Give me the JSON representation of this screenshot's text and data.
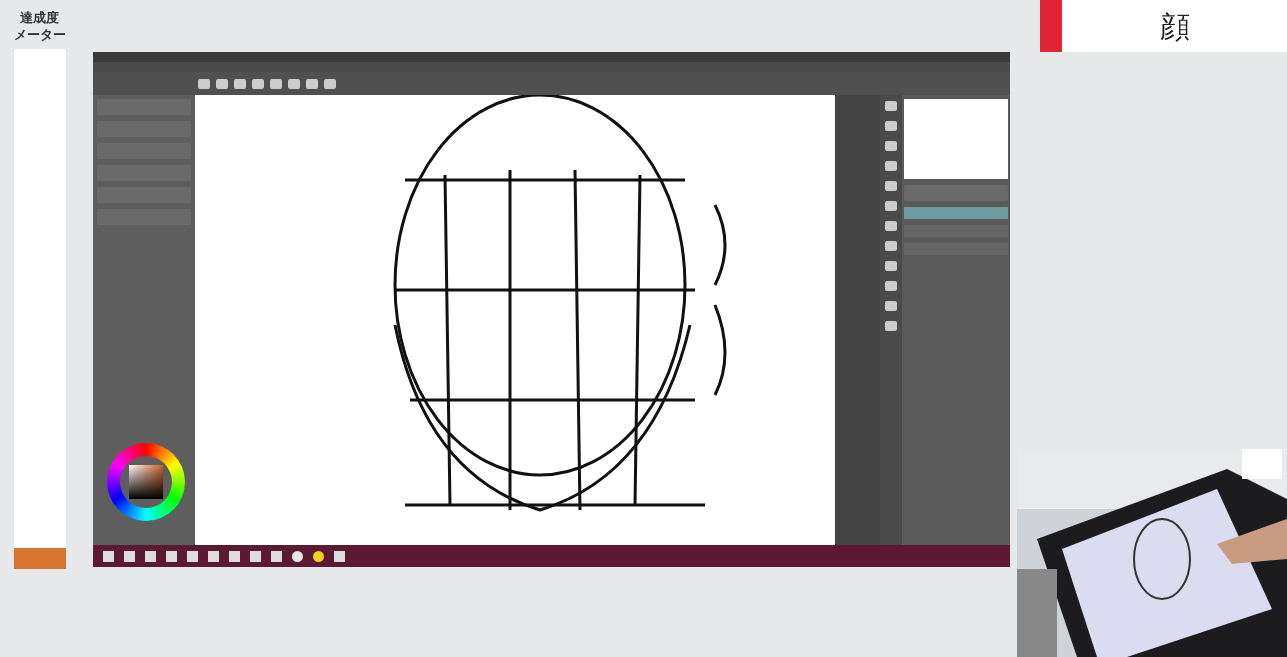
{
  "meter": {
    "label_lines": [
      "達成度",
      "メーター"
    ],
    "level": 0.04
  },
  "topic": {
    "title": "顔"
  },
  "app": {
    "layers": [
      {
        "selected": true
      },
      {
        "selected": false
      },
      {
        "selected": false
      }
    ],
    "taskbar_icons": [
      {
        "kind": "square"
      },
      {
        "kind": "square"
      },
      {
        "kind": "square"
      },
      {
        "kind": "square"
      },
      {
        "kind": "square"
      },
      {
        "kind": "square"
      },
      {
        "kind": "square"
      },
      {
        "kind": "square"
      },
      {
        "kind": "square"
      },
      {
        "kind": "circle",
        "color": "#e8e8e8"
      },
      {
        "kind": "circle",
        "color": "#f0d020"
      },
      {
        "kind": "square"
      }
    ]
  }
}
